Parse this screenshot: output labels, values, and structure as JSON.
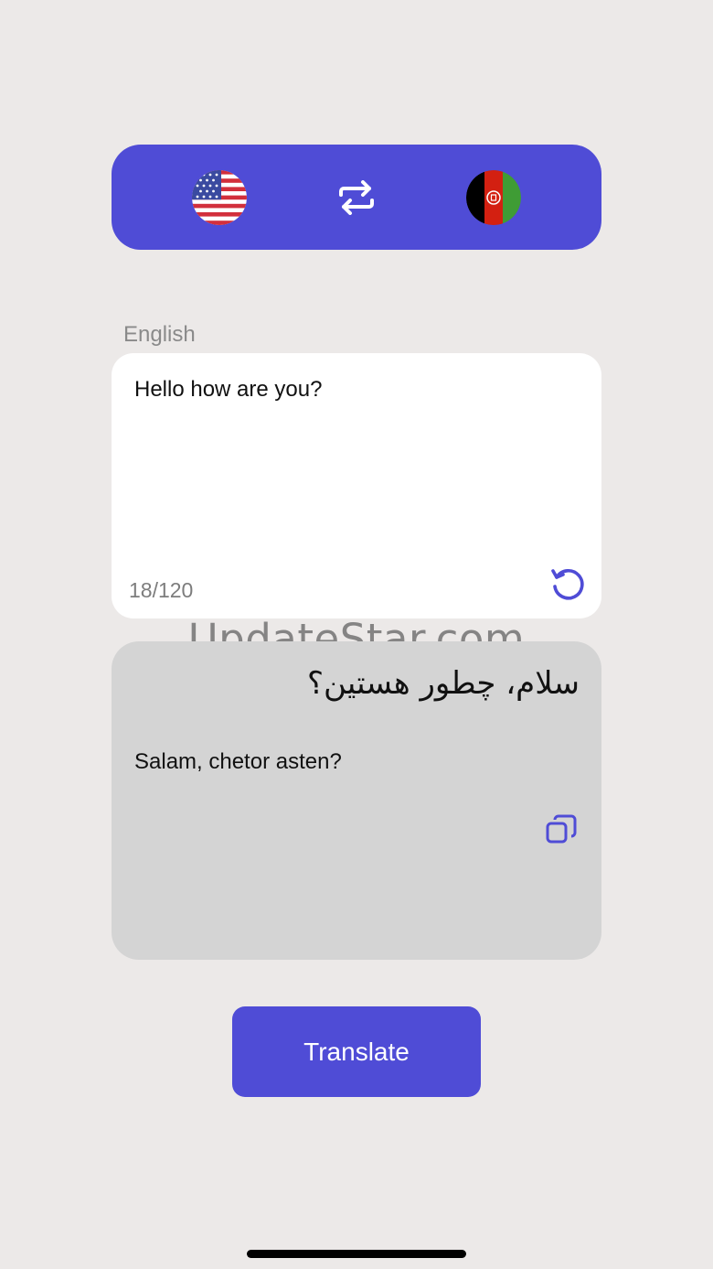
{
  "colors": {
    "background": "#ece9e8",
    "accent": "#4f4cd6",
    "card": "#ffffff",
    "output_card": "#d4d4d4"
  },
  "language_bar": {
    "source_flag_icon": "us-flag-icon",
    "swap_icon": "swap-arrows-icon",
    "target_flag_icon": "afghanistan-flag-icon"
  },
  "input": {
    "language_label": "English",
    "text": "Hello how are you?",
    "char_count": "18/120",
    "reset_icon": "reset-icon"
  },
  "watermark": "UpdateStar.com",
  "output": {
    "native_text": "سلام، چطور هستین؟",
    "romanized_text": "Salam, chetor asten?",
    "copy_icon": "copy-icon"
  },
  "actions": {
    "translate_label": "Translate"
  }
}
